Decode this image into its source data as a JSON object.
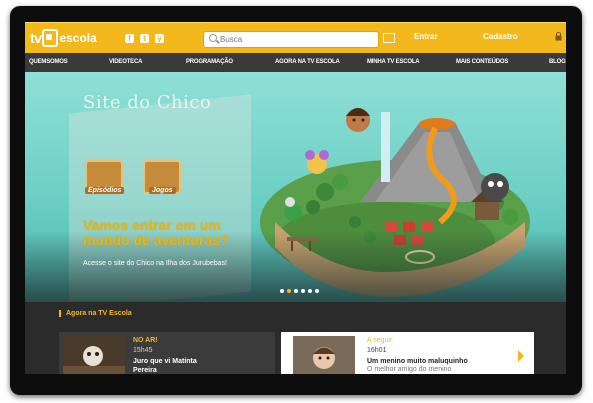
{
  "header": {
    "logo_tv": "tv",
    "logo_escola": "escola",
    "social": [
      "f",
      "t",
      "y"
    ],
    "search_placeholder": "Busca",
    "login": "Entrar",
    "cadastro": "Cadastro"
  },
  "nav": {
    "items": [
      "QUEMSOMOS",
      "VIDEOTECA",
      "PROGRAMAÇÃO",
      "AGORA NA TV ESCOLA",
      "MINHA TV ESCOLA",
      "MAIS CONTEÚDOS",
      "BLOG"
    ]
  },
  "hero": {
    "title": "Site do Chico",
    "badge1": "Episódios",
    "badge2": "Jogos",
    "headline": "Vamos entrar em um mundo de aventuras?",
    "subtext": "Acesse o site do Chico na Ilha dos Jurubebas!",
    "slides": 6,
    "active_slide": 2
  },
  "section": {
    "title": "Agora na TV Escola",
    "now": {
      "status": "NO AR!",
      "time": "15h45",
      "program": "Juro que vi Matinta Pereira"
    },
    "next": {
      "status": "A seguir",
      "time": "16h01",
      "program": "Um menino muito maluquinho",
      "subtitle": "O melhor amigo do menino"
    }
  },
  "colors": {
    "accent": "#f2b81c",
    "nav_bg": "#3a3a3a",
    "hero_bg": "#6ccfc5"
  }
}
